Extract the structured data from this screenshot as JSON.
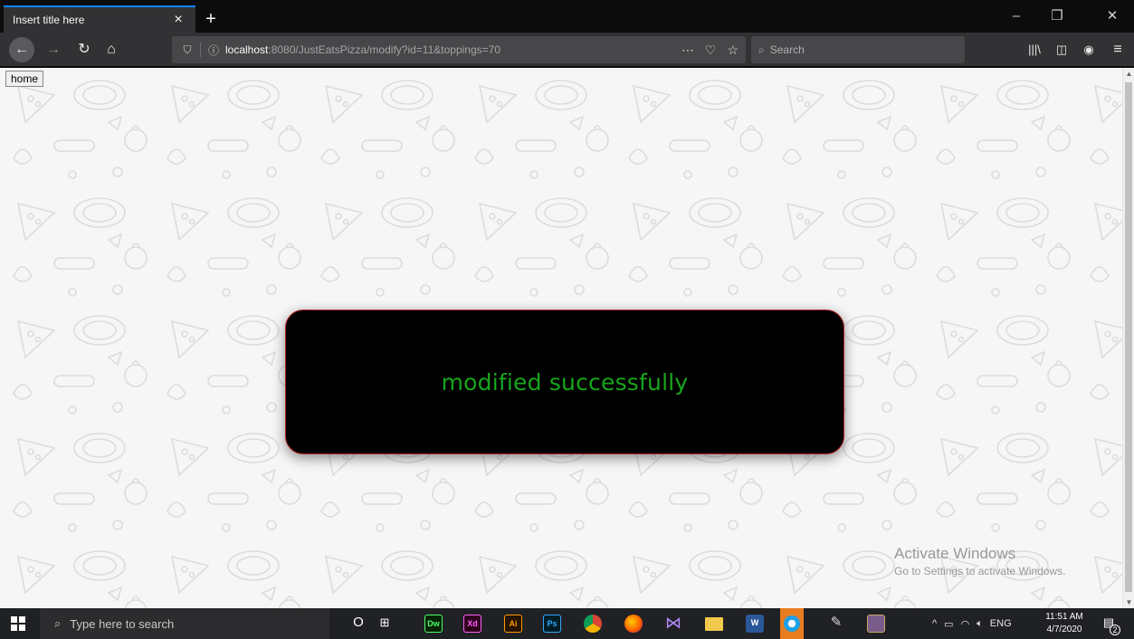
{
  "browser": {
    "tab_title": "Insert title here",
    "tab_close": "×",
    "new_tab": "+",
    "url_host": "localhost",
    "url_path": ":8080/JustEatsPizza/modify?id=11&toppings=70",
    "search_placeholder": "Search",
    "window_controls": {
      "minimize": "–",
      "restore": "❐",
      "close": "✕"
    }
  },
  "page": {
    "home_button": "home",
    "message": "modified successfully",
    "colors": {
      "message_text": "#17a51c",
      "message_bg": "#000000",
      "message_border": "#b22222"
    }
  },
  "watermark": {
    "line1": "Activate Windows",
    "line2": "Go to Settings to activate Windows."
  },
  "taskbar": {
    "search_placeholder": "Type here to search",
    "apps": [
      {
        "icon": "cortana-icon",
        "label": "O"
      },
      {
        "icon": "task-view-icon",
        "label": "⊞"
      },
      {
        "icon": "dreamweaver-icon",
        "label": "Dw",
        "color": "#4afd6e"
      },
      {
        "icon": "xd-icon",
        "label": "Xd",
        "color": "#ff61f6"
      },
      {
        "icon": "illustrator-icon",
        "label": "Ai",
        "color": "#ff9a00"
      },
      {
        "icon": "photoshop-icon",
        "label": "Ps",
        "color": "#31a8ff"
      },
      {
        "icon": "chrome-icon",
        "label": ""
      },
      {
        "icon": "firefox-icon",
        "label": ""
      },
      {
        "icon": "visual-studio-icon",
        "label": ""
      },
      {
        "icon": "file-explorer-icon",
        "label": ""
      },
      {
        "icon": "word-icon",
        "label": "W"
      },
      {
        "icon": "app-circle-icon",
        "label": ""
      },
      {
        "icon": "paint-icon",
        "label": ""
      },
      {
        "icon": "app-tile-icon",
        "label": ""
      }
    ],
    "tray": {
      "language": "ENG",
      "time": "11:51 AM",
      "date": "4/7/2020",
      "notifications": "2"
    }
  }
}
